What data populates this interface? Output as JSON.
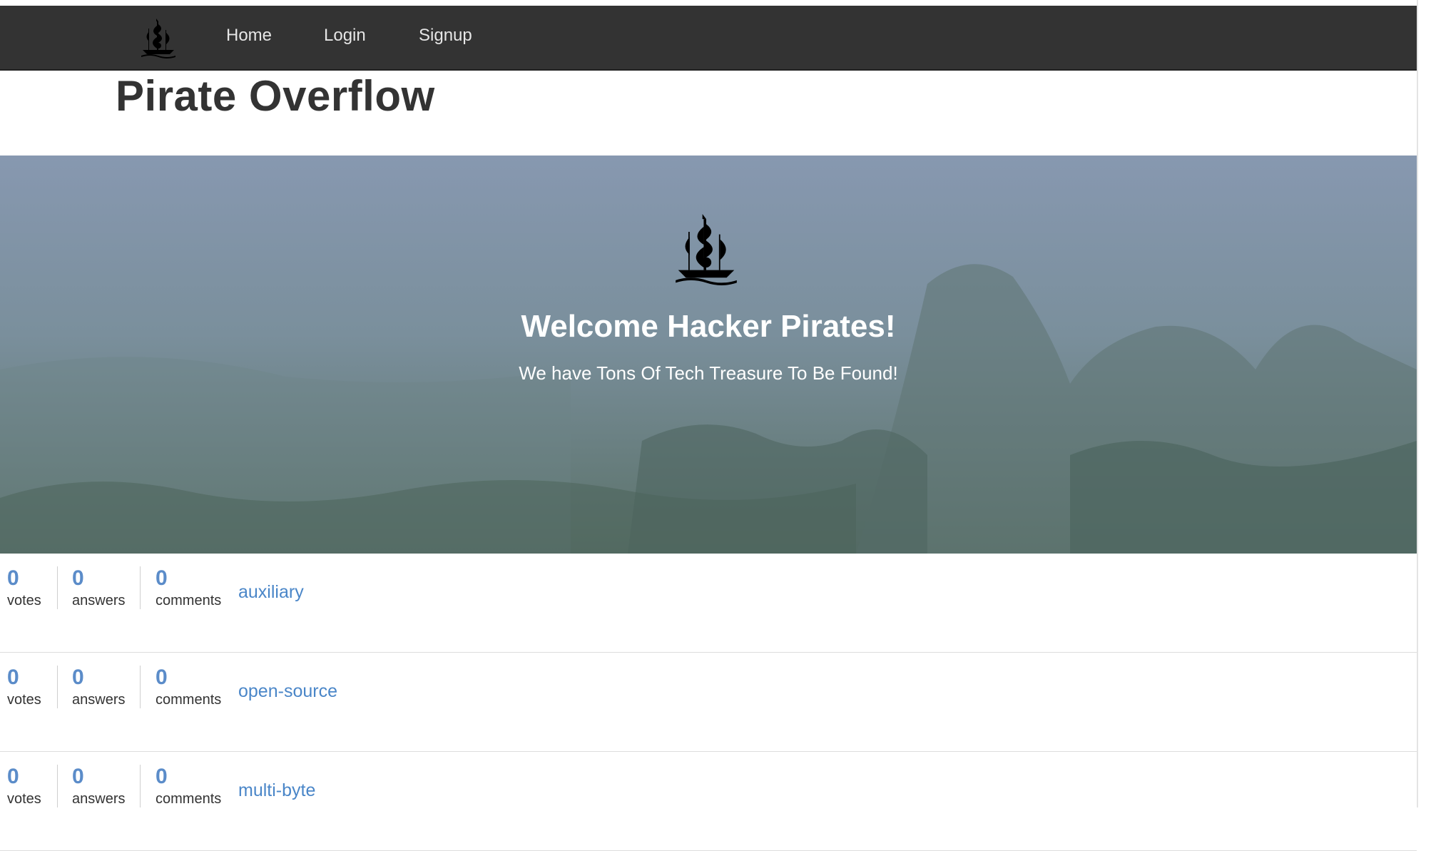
{
  "site": {
    "title": "Pirate Overflow"
  },
  "nav": {
    "logo_icon": "pirate-ship-icon",
    "links": [
      {
        "label": "Home"
      },
      {
        "label": "Login"
      },
      {
        "label": "Signup"
      }
    ],
    "background": "#333333",
    "link_color": "#e6e6e6"
  },
  "hero": {
    "logo_icon": "pirate-ship-icon",
    "title": "Welcome Hacker Pirates!",
    "subtitle": "We have Tons Of Tech Treasure To Be Found!"
  },
  "questions": [
    {
      "votes": "0",
      "votes_label": "votes",
      "answers": "0",
      "answers_label": "answers",
      "comments": "0",
      "comments_label": "comments",
      "title": "auxiliary"
    },
    {
      "votes": "0",
      "votes_label": "votes",
      "answers": "0",
      "answers_label": "answers",
      "comments": "0",
      "comments_label": "comments",
      "title": "open-source"
    },
    {
      "votes": "0",
      "votes_label": "votes",
      "answers": "0",
      "answers_label": "answers",
      "comments": "0",
      "comments_label": "comments",
      "title": "multi-byte"
    }
  ],
  "colors": {
    "accent": "#5b8cc9",
    "link": "#4a86c8"
  }
}
